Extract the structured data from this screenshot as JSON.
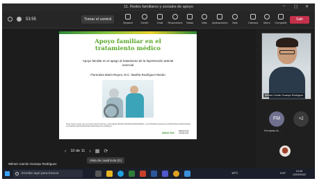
{
  "window": {
    "title": "11. Redes familiares y sociales de apoyo"
  },
  "toolbar": {
    "timer": "53:55",
    "take_control": "Tomar el control",
    "tools": [
      {
        "label": "Separar",
        "icon": "pop-out-icon"
      },
      {
        "label": "Gente",
        "icon": "people-icon"
      },
      {
        "label": "Chat",
        "icon": "chat-icon"
      },
      {
        "label": "Reacciones",
        "icon": "reactions-icon"
      },
      {
        "label": "Salas",
        "icon": "rooms-icon"
      },
      {
        "label": "Más",
        "icon": "more-icon"
      },
      {
        "label": "Aplicaciones",
        "icon": "apps-icon"
      },
      {
        "label": "Más",
        "icon": "ellipsis-icon"
      },
      {
        "label": "Cámara",
        "icon": "camera-icon"
      },
      {
        "label": "Micro",
        "icon": "mic-icon"
      },
      {
        "label": "Compartir",
        "icon": "share-icon"
      }
    ],
    "leave_label": "Salir"
  },
  "slide": {
    "title": "Apoyo familiar en el\ntratamiento médico",
    "subtitle": "Apoyo familiar en el apego al tratamiento de la hipertensión arterial\nesencial",
    "authors": "Florentina Marin-Reyes, M.C. Martha Rodríguez-Morán",
    "reference": "https://www.scielo.org.mx/scielo.php?script=sci_arttext&pid=S0036-36342001000400006#:~:text=Si%20consideramos%20%20que%20el%20apoyo%20familiar%20a%20familiar%20contri-%20buye...",
    "logo_primary": "Alton Kal",
    "logo_secondary": "MEDICINA\nFAMILIAR"
  },
  "slide_nav": {
    "page": "10 de 11",
    "tooltip": "Vista de cuadrícula (G)"
  },
  "presenter": {
    "name": "Wilmer Camilo Ocampo Rodríguez"
  },
  "participants": {
    "video_label": "Wilmer Camilo Ocampo Rodriguez",
    "fm_initials": "FM",
    "fm_name": "Fernando M...",
    "more_count": "+2"
  },
  "taskbar": {
    "search_placeholder": "Escribe aquí para buscar",
    "temperature": "18°C",
    "language": "ESP",
    "time": "10:40",
    "date": "12/09/2022"
  },
  "colors": {
    "leave": "#c4314b",
    "slide_title": "#5aa82a",
    "taskbar": "#1b1f2b"
  }
}
